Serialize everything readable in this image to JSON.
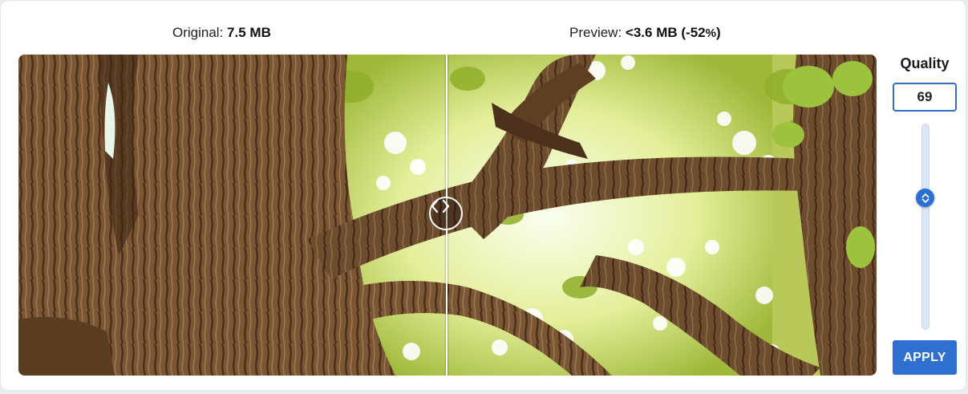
{
  "labels": {
    "original_prefix": "Original:",
    "original_size": "7.5 MB",
    "preview_prefix": "Preview:",
    "preview_size": "<3.6 MB (-52",
    "preview_pct_sign": "%",
    "preview_close": ")"
  },
  "quality": {
    "title": "Quality",
    "value": "69",
    "slider_fraction": 0.69
  },
  "apply_label": "APPLY",
  "icons": {
    "handle": "chevron-left-right-icon",
    "thumb": "chevron-up-down-icon"
  },
  "colors": {
    "accent": "#2f6fd0",
    "input_border": "#2f6fc4"
  }
}
